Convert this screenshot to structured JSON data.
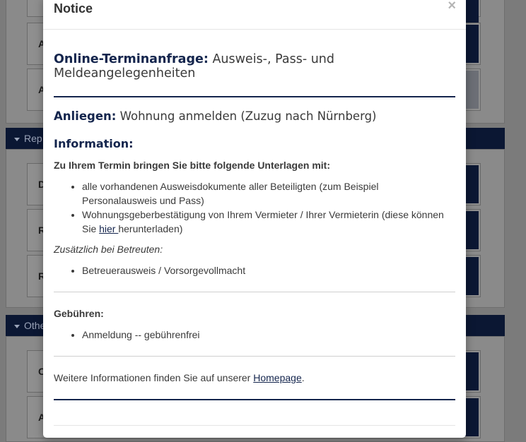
{
  "background": {
    "section_headers": [
      "Rep",
      "Othe"
    ],
    "cards": [
      "A",
      "A",
      "D",
      "R",
      "R",
      "C",
      "A"
    ]
  },
  "modal": {
    "title": "Notice",
    "close_label": "×",
    "heading_bold": "Online-Terminanfrage:",
    "heading_rest": " Ausweis-, Pass- und Meldeangelegenheiten",
    "anliegen_label": "Anliegen:",
    "anliegen_value": " Wohnung anmelden (Zuzug nach Nürnberg)",
    "info_heading": "Information:",
    "bring_text": "Zu Ihrem Termin bringen Sie bitte folgende Unterlagen mit:",
    "documents": [
      "alle vorhandenen Ausweisdokumente aller Beteiligten (zum Beispiel Personalausweis und Pass)"
    ],
    "doc2_before": "Wohnungsgeberbestätigung von Ihrem Vermieter / Ihrer Vermieterin (diese können Sie ",
    "doc2_link": "hier ",
    "doc2_after": "herunterladen)",
    "betreuten_label": "Zusätzlich bei Betreuten:",
    "betreuten_items": [
      "Betreuerausweis / Vorsorgevollmacht"
    ],
    "fees_heading": "Gebühren:",
    "fees_items": [
      "Anmeldung -- gebührenfrei"
    ],
    "more_before": "Weitere Informationen finden Sie auf unserer ",
    "more_link": "Homepage",
    "more_after": "."
  }
}
